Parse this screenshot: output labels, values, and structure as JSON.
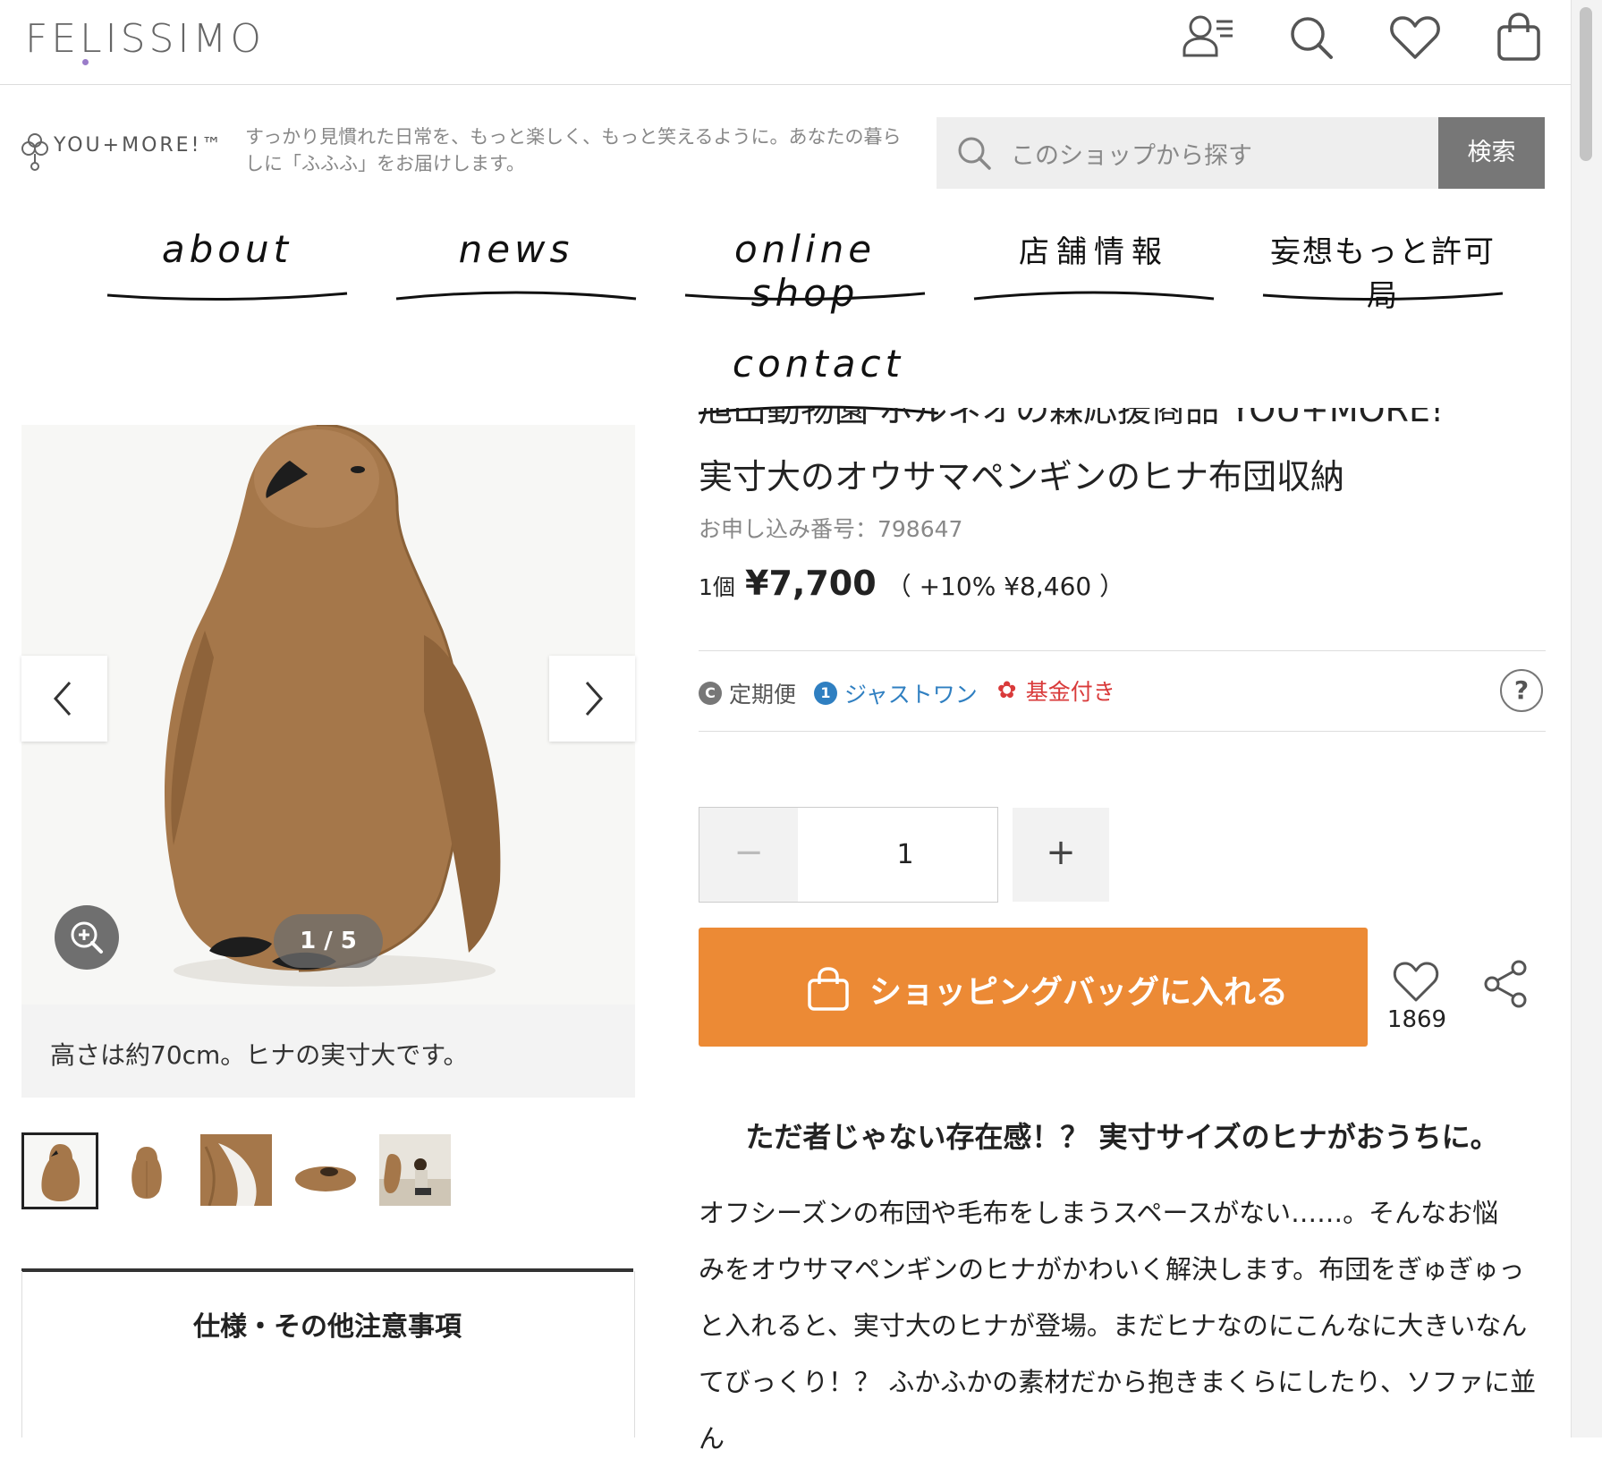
{
  "header": {
    "logo": "FELISSIMO",
    "icons": [
      "account-menu-icon",
      "search-icon",
      "heart-icon",
      "shopping-bag-icon"
    ]
  },
  "shop": {
    "brand": "YOU+MORE!™",
    "tagline": "すっかり見慣れた日常を、もっと楽しく、もっと笑えるように。あなたの暮らしに「ふふふ」をお届けします。",
    "search_placeholder": "このショップから探す",
    "search_button": "検索"
  },
  "nav": {
    "items": [
      {
        "label": "about"
      },
      {
        "label": "news"
      },
      {
        "label": "online shop"
      },
      {
        "label": "店舗情報"
      },
      {
        "label": "妄想もっと許可局"
      },
      {
        "label": "contact"
      }
    ]
  },
  "gallery": {
    "counter": "1 / 5",
    "caption": "高さは約70cm。ヒナの実寸大です。",
    "thumbnail_count": 5,
    "spec_title": "仕様・その他注意事項"
  },
  "product": {
    "title_partial": "旭山動物園 ボルネオの森応援商品 YOU+MORE!",
    "title": "実寸大のオウサマペンギンのヒナ布団収納",
    "order_number": "お申し込み番号：798647",
    "qty_label": "1個",
    "price": "¥7,700",
    "price_tax": "（ +10%  ¥8,460 ）",
    "tags": [
      {
        "label": "定期便",
        "color": "#555555"
      },
      {
        "label": "ジャストワン",
        "color": "#2f7fc1"
      },
      {
        "label": "基金付き",
        "color": "#d93a3a"
      }
    ],
    "help": "?",
    "quantity": "1",
    "minus": "−",
    "plus": "+",
    "cart_button": "ショッピングバッグに入れる",
    "favorites": "1869",
    "accent_color": "#ec8a35"
  },
  "description": {
    "headline": "ただ者じゃない存在感！？ 実寸サイズのヒナがおうちに。",
    "lines": [
      "オフシーズンの布団や毛布をしまうスペースがない……。そんなお悩",
      "みをオウサマペンギンのヒナがかわいく解決します。布団をぎゅぎゅっ",
      "と入れると、実寸大のヒナが登場。まだヒナなのにこんなに大きいなん",
      "てびっくり！？ ふかふかの素材だから抱きまくらにしたり、ソファに並ん"
    ]
  }
}
